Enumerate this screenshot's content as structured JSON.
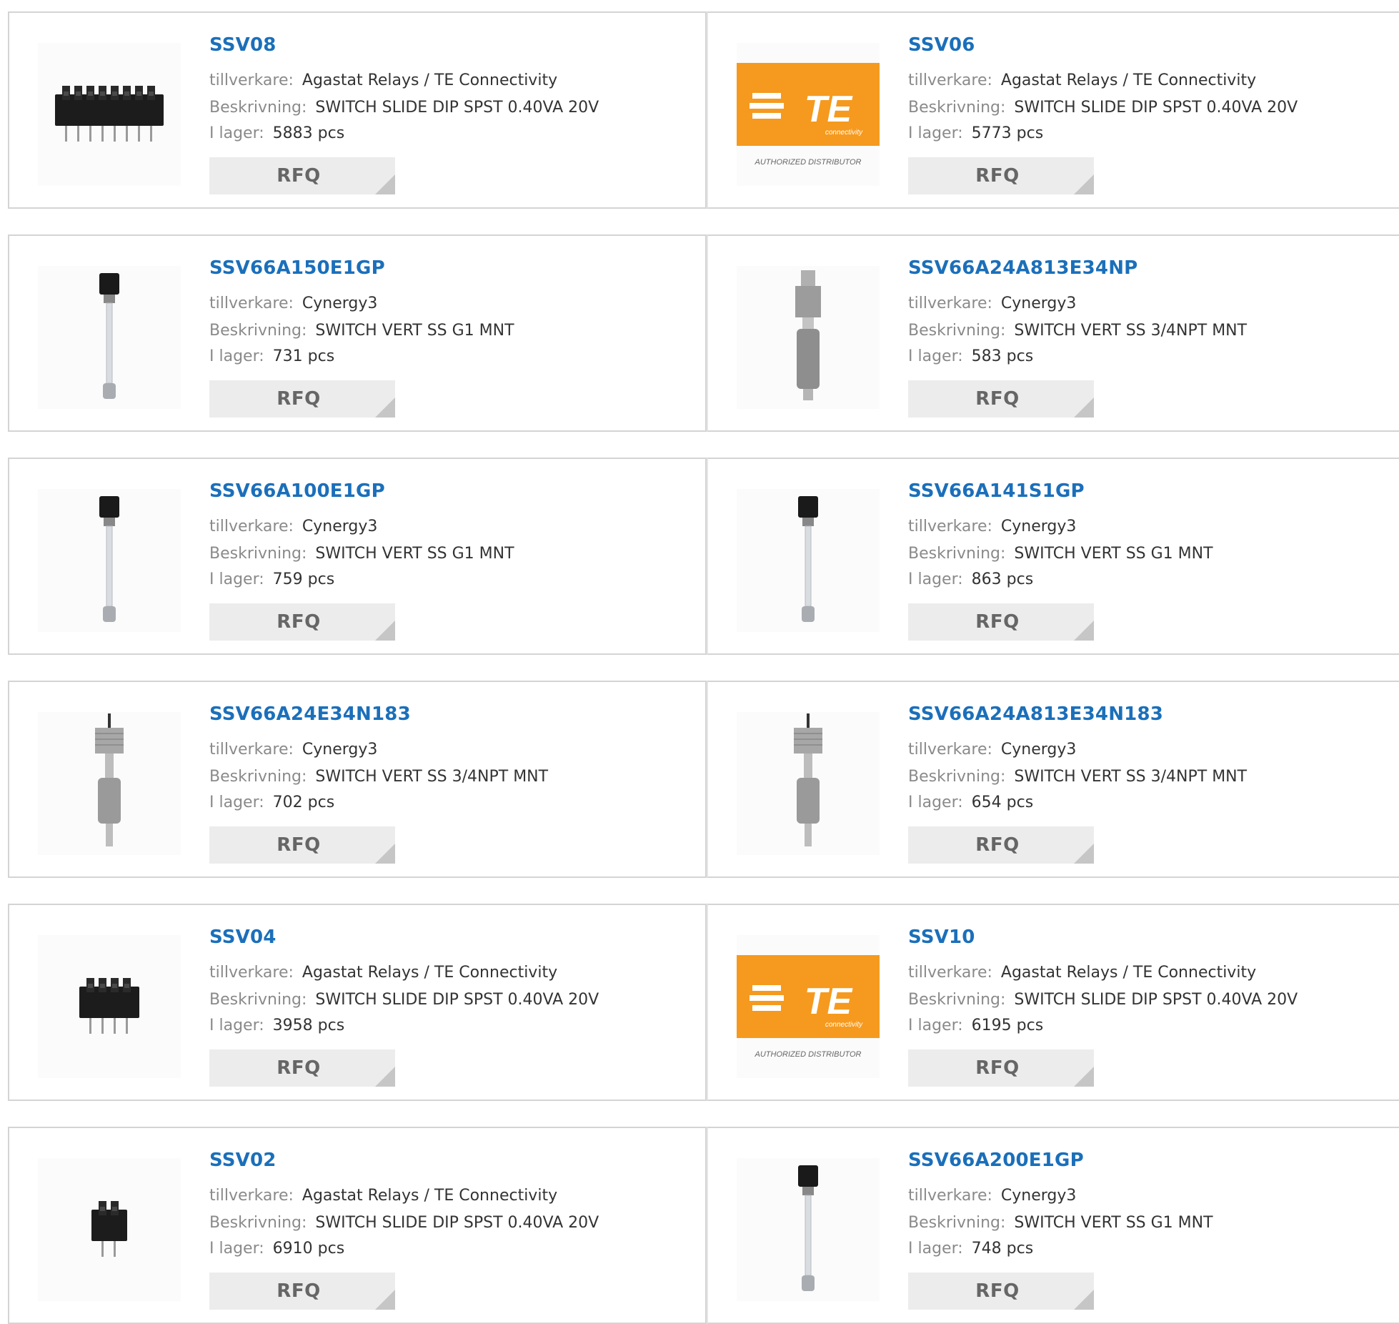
{
  "labels": {
    "manufacturer": "tillverkare:",
    "description": "Beskrivning:",
    "stock": "I lager:",
    "rfq": "RFQ"
  },
  "te_logo": {
    "word": "TE",
    "sub": "connectivity",
    "caption": "AUTHORIZED DISTRIBUTOR"
  },
  "products": [
    {
      "part": "SSV08",
      "manufacturer": "Agastat Relays / TE Connectivity",
      "description": "SWITCH SLIDE DIP SPST 0.40VA 20V",
      "stock": "5883 pcs",
      "image": "dip-switch-8"
    },
    {
      "part": "SSV06",
      "manufacturer": "Agastat Relays / TE Connectivity",
      "description": "SWITCH SLIDE DIP SPST 0.40VA 20V",
      "stock": "5773 pcs",
      "image": "te-logo"
    },
    {
      "part": "SSV66A150E1GP",
      "manufacturer": "Cynergy3",
      "description": "SWITCH VERT SS G1 MNT",
      "stock": "731 pcs",
      "image": "float-rod"
    },
    {
      "part": "SSV66A24A813E34NP",
      "manufacturer": "Cynergy3",
      "description": "SWITCH VERT SS 3/4NPT MNT",
      "stock": "583 pcs",
      "image": "float-metal"
    },
    {
      "part": "SSV66A100E1GP",
      "manufacturer": "Cynergy3",
      "description": "SWITCH VERT SS G1 MNT",
      "stock": "759 pcs",
      "image": "float-rod"
    },
    {
      "part": "SSV66A141S1GP",
      "manufacturer": "Cynergy3",
      "description": "SWITCH VERT SS G1 MNT",
      "stock": "863 pcs",
      "image": "float-rod"
    },
    {
      "part": "SSV66A24E34N183",
      "manufacturer": "Cynergy3",
      "description": "SWITCH VERT SS 3/4NPT MNT",
      "stock": "702 pcs",
      "image": "float-threaded"
    },
    {
      "part": "SSV66A24A813E34N183",
      "manufacturer": "Cynergy3",
      "description": "SWITCH VERT SS 3/4NPT MNT",
      "stock": "654 pcs",
      "image": "float-threaded"
    },
    {
      "part": "SSV04",
      "manufacturer": "Agastat Relays / TE Connectivity",
      "description": "SWITCH SLIDE DIP SPST 0.40VA 20V",
      "stock": "3958 pcs",
      "image": "dip-switch-4"
    },
    {
      "part": "SSV10",
      "manufacturer": "Agastat Relays / TE Connectivity",
      "description": "SWITCH SLIDE DIP SPST 0.40VA 20V",
      "stock": "6195 pcs",
      "image": "te-logo"
    },
    {
      "part": "SSV02",
      "manufacturer": "Agastat Relays / TE Connectivity",
      "description": "SWITCH SLIDE DIP SPST 0.40VA 20V",
      "stock": "6910 pcs",
      "image": "dip-switch-2"
    },
    {
      "part": "SSV66A200E1GP",
      "manufacturer": "Cynergy3",
      "description": "SWITCH VERT SS G1 MNT",
      "stock": "748 pcs",
      "image": "float-rod"
    }
  ],
  "colors": {
    "link": "#1b6fba",
    "label": "#8a8a8a",
    "value": "#333333",
    "rfq_bg": "#ececec",
    "te_orange": "#f59a1e"
  }
}
